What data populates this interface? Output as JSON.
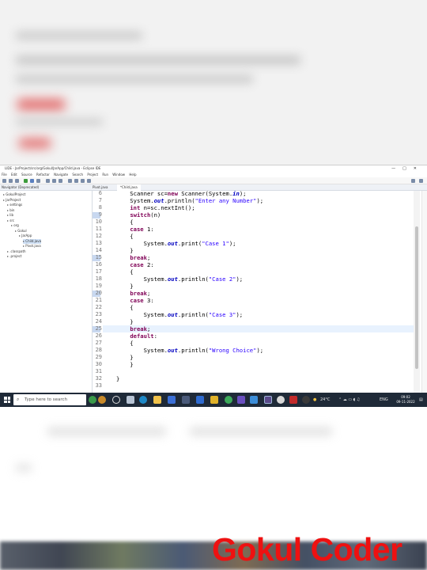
{
  "window": {
    "title": "LIDE - JarProject/src/org/Gokul/JarApp/Child.java - Eclipse IDE",
    "controls": [
      "—",
      "□",
      "✕"
    ]
  },
  "menu": [
    "File",
    "Edit",
    "Source",
    "Refactor",
    "Navigate",
    "Search",
    "Project",
    "Run",
    "Window",
    "Help"
  ],
  "tabs": {
    "navigator": "Navigator (Deprecated)",
    "pivot": "Pivot.java",
    "child": "*Child.java"
  },
  "navigator_items": [
    {
      "label": "GokulProject",
      "indent": 0
    },
    {
      "label": "JarProject",
      "indent": 0
    },
    {
      "label": "settings",
      "indent": 1
    },
    {
      "label": "bin",
      "indent": 1
    },
    {
      "label": "lib",
      "indent": 1
    },
    {
      "label": "src",
      "indent": 1
    },
    {
      "label": "org",
      "indent": 2
    },
    {
      "label": "Gokul",
      "indent": 3
    },
    {
      "label": "JarApp",
      "indent": 4
    },
    {
      "label": "Child.java",
      "indent": 5,
      "selected": true
    },
    {
      "label": "Pivot.java",
      "indent": 5
    },
    {
      "label": ".classpath",
      "indent": 1
    },
    {
      "label": ".project",
      "indent": 1
    }
  ],
  "code_lines": [
    {
      "num": "6",
      "tokens": [
        {
          "t": "    Scanner sc="
        },
        {
          "t": "new",
          "c": "kw"
        },
        {
          "t": " Scanner(System."
        },
        {
          "t": "in",
          "c": "fld"
        },
        {
          "t": ");"
        }
      ]
    },
    {
      "num": "7",
      "tokens": [
        {
          "t": "    System."
        },
        {
          "t": "out",
          "c": "fld"
        },
        {
          "t": ".println("
        },
        {
          "t": "\"Enter any Number\"",
          "c": "str"
        },
        {
          "t": ");"
        }
      ]
    },
    {
      "num": "8",
      "tokens": [
        {
          "t": "    "
        },
        {
          "t": "int",
          "c": "kw"
        },
        {
          "t": " n=sc.nextInt();"
        }
      ]
    },
    {
      "num": "9",
      "tokens": [
        {
          "t": "    "
        },
        {
          "t": "switch",
          "c": "kw"
        },
        {
          "t": "(n)"
        }
      ]
    },
    {
      "num": "10",
      "tokens": [
        {
          "t": "    {"
        }
      ]
    },
    {
      "num": "11",
      "tokens": [
        {
          "t": "    "
        },
        {
          "t": "case",
          "c": "kw"
        },
        {
          "t": " 1:"
        }
      ]
    },
    {
      "num": "12",
      "tokens": [
        {
          "t": "    {"
        }
      ]
    },
    {
      "num": "13",
      "tokens": [
        {
          "t": "        System."
        },
        {
          "t": "out",
          "c": "fld"
        },
        {
          "t": ".print("
        },
        {
          "t": "\"Case 1\"",
          "c": "str"
        },
        {
          "t": ");"
        }
      ]
    },
    {
      "num": "14",
      "tokens": [
        {
          "t": "    }"
        }
      ]
    },
    {
      "num": "15",
      "tokens": [
        {
          "t": "    "
        },
        {
          "t": "break",
          "c": "kw"
        },
        {
          "t": ";"
        }
      ]
    },
    {
      "num": "16",
      "tokens": [
        {
          "t": "    "
        },
        {
          "t": "case",
          "c": "kw"
        },
        {
          "t": " 2:"
        }
      ]
    },
    {
      "num": "17",
      "tokens": [
        {
          "t": "    {"
        }
      ]
    },
    {
      "num": "18",
      "tokens": [
        {
          "t": "        System."
        },
        {
          "t": "out",
          "c": "fld"
        },
        {
          "t": ".println("
        },
        {
          "t": "\"Case 2\"",
          "c": "str"
        },
        {
          "t": ");"
        }
      ]
    },
    {
      "num": "19",
      "tokens": [
        {
          "t": "    }"
        }
      ]
    },
    {
      "num": "20",
      "tokens": [
        {
          "t": "    "
        },
        {
          "t": "break",
          "c": "kw"
        },
        {
          "t": ";"
        }
      ]
    },
    {
      "num": "21",
      "tokens": [
        {
          "t": "    "
        },
        {
          "t": "case",
          "c": "kw"
        },
        {
          "t": " 3:"
        }
      ]
    },
    {
      "num": "22",
      "tokens": [
        {
          "t": "    {"
        }
      ]
    },
    {
      "num": "23",
      "tokens": [
        {
          "t": "        System."
        },
        {
          "t": "out",
          "c": "fld"
        },
        {
          "t": ".println("
        },
        {
          "t": "\"Case 3\"",
          "c": "str"
        },
        {
          "t": ");"
        }
      ]
    },
    {
      "num": "24",
      "tokens": [
        {
          "t": "    }"
        }
      ]
    },
    {
      "num": "25",
      "tokens": [
        {
          "t": "    "
        },
        {
          "t": "break",
          "c": "kw"
        },
        {
          "t": ";"
        }
      ],
      "current": true
    },
    {
      "num": "26",
      "tokens": [
        {
          "t": "    "
        },
        {
          "t": "default",
          "c": "kw"
        },
        {
          "t": ":"
        }
      ]
    },
    {
      "num": "27",
      "tokens": [
        {
          "t": "    {"
        }
      ]
    },
    {
      "num": "28",
      "tokens": [
        {
          "t": "        System."
        },
        {
          "t": "out",
          "c": "fld"
        },
        {
          "t": ".println("
        },
        {
          "t": "\"Wrong Choice\"",
          "c": "str"
        },
        {
          "t": ");"
        }
      ]
    },
    {
      "num": "29",
      "tokens": [
        {
          "t": "    }"
        }
      ]
    },
    {
      "num": "30",
      "tokens": [
        {
          "t": "    }"
        }
      ]
    },
    {
      "num": "31",
      "tokens": [
        {
          "t": ""
        }
      ]
    },
    {
      "num": "32",
      "tokens": [
        {
          "t": "}"
        }
      ]
    },
    {
      "num": "33",
      "tokens": [
        {
          "t": ""
        }
      ]
    }
  ],
  "status": {
    "mode": "Writable",
    "insert": "Smart Insert",
    "position": "25 : 17 : 404"
  },
  "taskbar": {
    "search_placeholder": "Type here to search",
    "weather": "24°C",
    "lang": "ENG",
    "time": "09:02",
    "date": "09-11-2022"
  },
  "watermark": "Gokul Coder",
  "colors": {
    "keyword": "#7f0055",
    "string": "#2a00ff",
    "field": "#0000c0",
    "watermark": "#ee1111",
    "taskbar": "#1f2a38"
  }
}
